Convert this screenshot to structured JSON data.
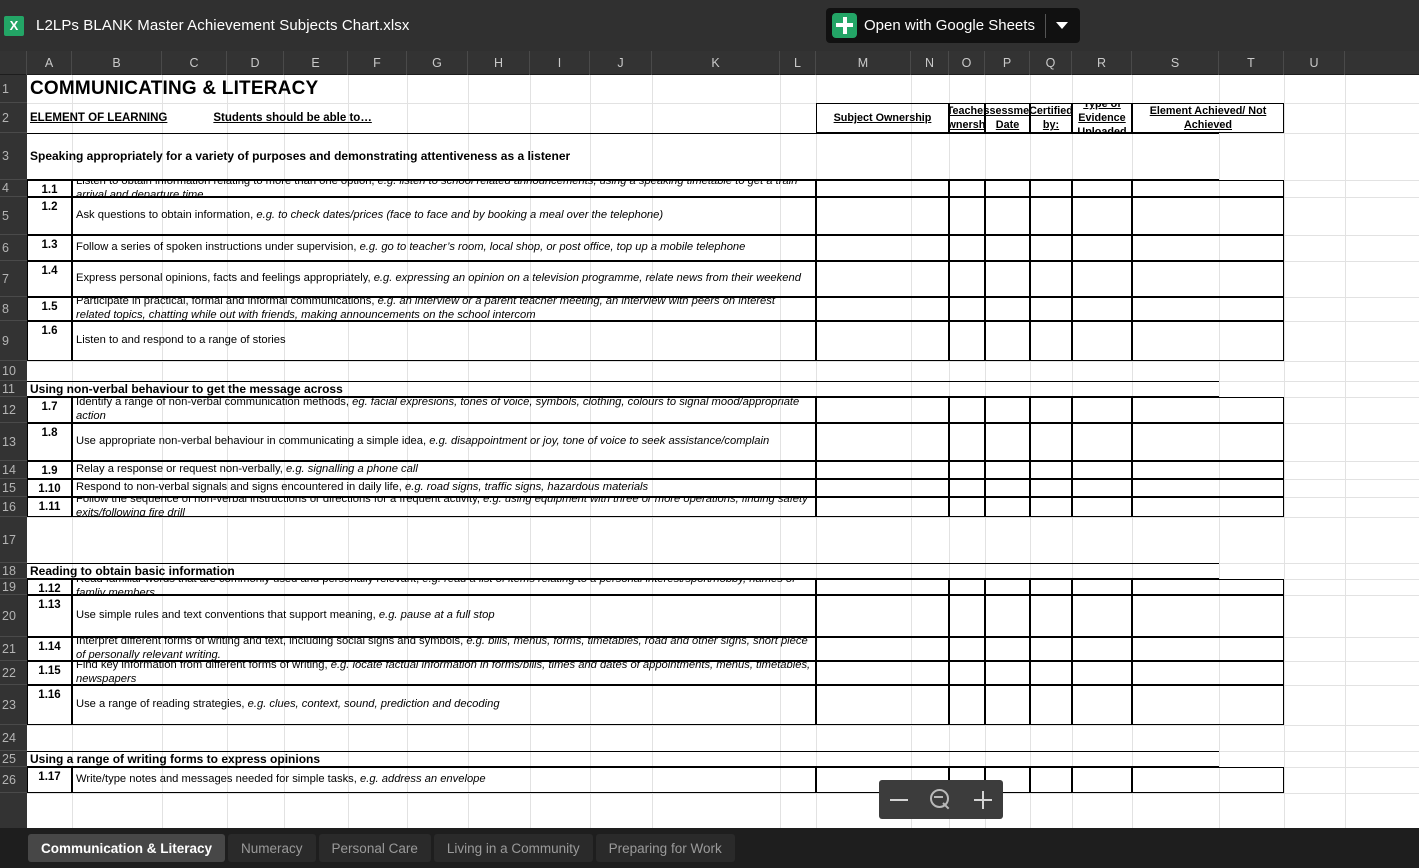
{
  "window": {
    "file_icon_letter": "X",
    "file_title": "L2LPs BLANK Master Achievement Subjects Chart.xlsx",
    "open_button_label": "Open with Google Sheets"
  },
  "grid": {
    "column_headers": [
      "A",
      "B",
      "C",
      "D",
      "E",
      "F",
      "G",
      "H",
      "I",
      "J",
      "K",
      "L",
      "M",
      "N",
      "O",
      "P",
      "Q",
      "R",
      "S",
      "T",
      "U"
    ],
    "row_numbers": [
      "1",
      "2",
      "3",
      "4",
      "5",
      "6",
      "7",
      "8",
      "9",
      "10",
      "11",
      "12",
      "13",
      "14",
      "15",
      "16",
      "17",
      "18",
      "19",
      "20",
      "21",
      "22",
      "23",
      "24",
      "25",
      "26"
    ]
  },
  "sheet": {
    "title": "COMMUNICATING & LITERACY",
    "element_of_learning_label": "ELEMENT OF LEARNING",
    "students_should_label": "Students should be able to…",
    "assessment_headers": [
      "Subject Ownership",
      "Teacher Ownership",
      "Assessment Date",
      "Certified by:",
      "Type of Evidence Uploaded",
      "Element Achieved/ Not Achieved"
    ],
    "sections": [
      {
        "heading": "Speaking appropriately for a variety of purposes and demonstrating attentiveness as a listener",
        "items": [
          {
            "ref": "1.1",
            "text": "Listen to obtain information relating to more than one option, ",
            "eg": "e.g. listen to school related announcements, using a speaking timetable to get a train arrival and departure time"
          },
          {
            "ref": "1.2",
            "text": "Ask questions to obtain information, ",
            "eg": "e.g. to check dates/prices (face to face and by booking a meal over the telephone)"
          },
          {
            "ref": "1.3",
            "text": "Follow a series of spoken instructions under supervision, ",
            "eg": "e.g. go to teacher’s room, local shop, or post office, top up a mobile telephone"
          },
          {
            "ref": "1.4",
            "text": "Express personal opinions, facts and feelings appropriately, ",
            "eg": "e.g. expressing an opinion on a television programme, relate news from their weekend"
          },
          {
            "ref": "1.5",
            "text": "Participate in practical, formal and informal communications, ",
            "eg": "e.g. an interview or a parent teacher meeting, an interview with peers on interest related topics, chatting while out with friends, making announcements on the school intercom"
          },
          {
            "ref": "1.6",
            "text": "Listen to and respond to a range of stories",
            "eg": ""
          }
        ]
      },
      {
        "heading": "Using non-verbal behaviour to get the message across",
        "items": [
          {
            "ref": "1.7",
            "text": "Identify a range of non-verbal communication methods, ",
            "eg": "eg. facial expresions, tones of voice, symbols, clothing, colours to signal mood/appropriate action"
          },
          {
            "ref": "1.8",
            "text": "Use appropriate non-verbal behaviour in communicating a simple idea, ",
            "eg": "e.g. disappointment or joy, tone of voice to seek assistance/complain"
          },
          {
            "ref": "1.9",
            "text": "Relay a response or request non-verbally, ",
            "eg": "e.g. signalling a phone call"
          },
          {
            "ref": "1.10",
            "text": "Respond to non-verbal signals and signs encountered in daily life, ",
            "eg": "e.g. road signs, traffic signs, hazardous materials"
          },
          {
            "ref": "1.11",
            "text": "Follow the sequence of non-verbal instructions or directions for a frequent activity, ",
            "eg": "e.g. using equipment with three or more operations, finding safety exits/following fire drill"
          }
        ]
      },
      {
        "heading": "Reading to obtain basic information",
        "items": [
          {
            "ref": "1.12",
            "text": "Read familiar words that are commonly used and personally relevant, ",
            "eg": "e.g. read a list of items relating to a personal interest/sport/hobby, names of famliy members"
          },
          {
            "ref": "1.13",
            "text": "Use simple rules and text conventions that support meaning, ",
            "eg": "e.g. pause at a full stop"
          },
          {
            "ref": "1.14",
            "text": "Interpret different forms of writing and text, including social signs and symbols, ",
            "eg": "e.g.  bliis, menus, forms, timetables, road and other signs, short piece of personally relevant writing."
          },
          {
            "ref": "1.15",
            "text": "Find key information from different forms of writing, ",
            "eg": "e.g. locate factual information in forms/bliis, times and dates of appointments, menus, timetables, newspapers"
          },
          {
            "ref": "1.16",
            "text": "Use a range of reading strategies, ",
            "eg": "e.g. clues, context, sound, prediction and decoding"
          }
        ]
      },
      {
        "heading": "Using a range of writing forms to express opinions",
        "items": [
          {
            "ref": "1.17",
            "text": "Write/type notes and messages needed for simple tasks, ",
            "eg": "e.g. address an envelope"
          }
        ]
      }
    ]
  },
  "zoom_control": {
    "zoom_out_label": "−",
    "zoom_in_label": "+"
  },
  "tabs": [
    {
      "label": "Communication & Literacy",
      "active": true
    },
    {
      "label": "Numeracy",
      "active": false
    },
    {
      "label": "Personal Care",
      "active": false
    },
    {
      "label": "Living in a Community",
      "active": false
    },
    {
      "label": "Preparing for Work",
      "active": false
    }
  ]
}
